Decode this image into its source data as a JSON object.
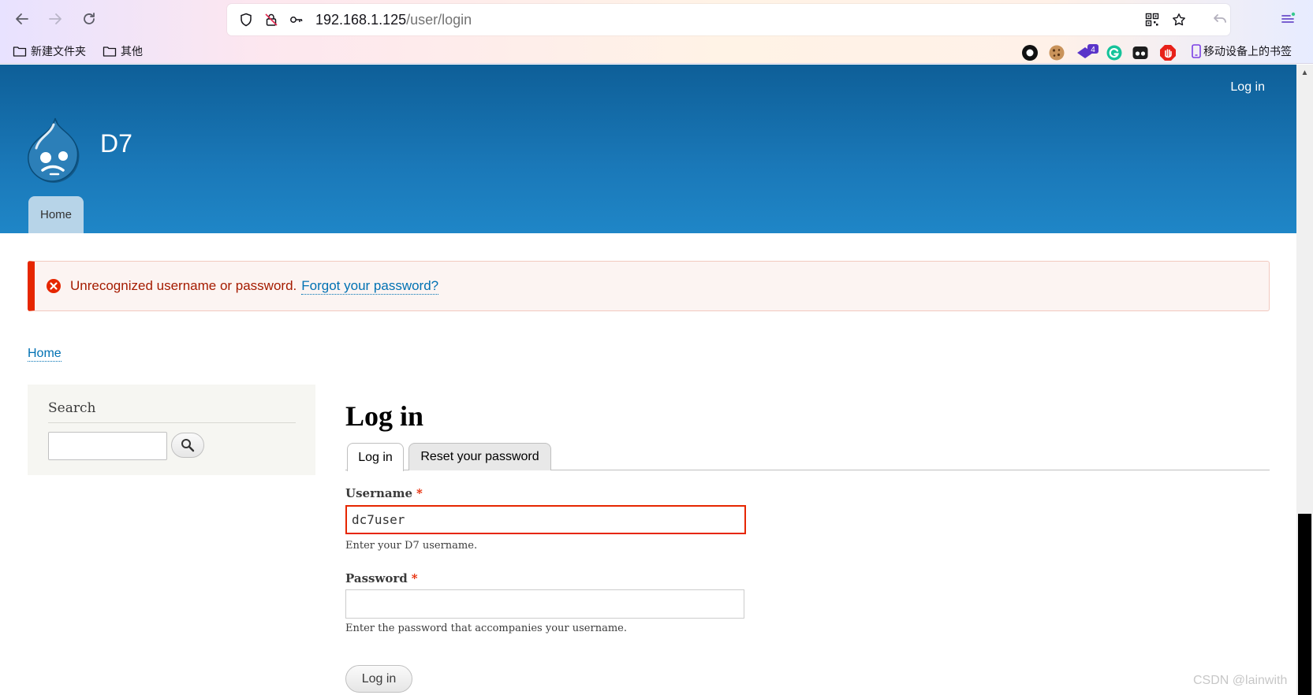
{
  "browser": {
    "url_host": "192.168.1.125",
    "url_path": "/user/login",
    "bookmarks": [
      {
        "label": "新建文件夹"
      },
      {
        "label": "其他"
      }
    ],
    "mobile_bookmarks": "移动设备上的书签",
    "extension_badge": "4"
  },
  "site": {
    "header_login": "Log in",
    "name": "D7",
    "main_menu": [
      "Home"
    ]
  },
  "message": {
    "error": "Unrecognized username or password.",
    "link": "Forgot your password?"
  },
  "breadcrumb": "Home",
  "sidebar": {
    "search_title": "Search",
    "search_value": ""
  },
  "main": {
    "title": "Log in",
    "tabs": [
      "Log in",
      "Reset your password"
    ],
    "username_label": "Username",
    "username_value": "dc7user",
    "username_desc": "Enter your D7 username.",
    "password_label": "Password",
    "password_value": "",
    "password_desc": "Enter the password that accompanies your username.",
    "required_marker": "*",
    "submit_label": "Log in"
  },
  "watermark": "CSDN @lainwith",
  "colors": {
    "header_top": "#0e5f98",
    "header_bottom": "#1f86c7",
    "error_red": "#e62600",
    "link_blue": "#0071b3"
  }
}
